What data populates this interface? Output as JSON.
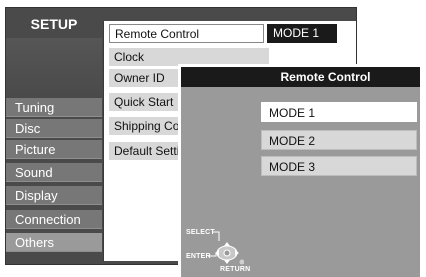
{
  "setup": {
    "title": "SETUP"
  },
  "sidebar": {
    "items": [
      {
        "label": "Tuning"
      },
      {
        "label": "Disc"
      },
      {
        "label": "Picture"
      },
      {
        "label": "Sound"
      },
      {
        "label": "Display"
      },
      {
        "label": "Connection"
      },
      {
        "label": "Others",
        "active": true
      }
    ]
  },
  "menu": {
    "items": [
      {
        "label": "Remote Control",
        "value": "MODE 1"
      },
      {
        "label": "Clock"
      },
      {
        "label": "Owner ID"
      },
      {
        "label": "Quick Start"
      },
      {
        "label": "Shipping Condition"
      },
      {
        "label": "Default Settings"
      }
    ]
  },
  "dialog": {
    "title": "Remote Control",
    "options": [
      {
        "label": "MODE 1",
        "selected": true
      },
      {
        "label": "MODE 2"
      },
      {
        "label": "MODE 3"
      }
    ]
  },
  "nav_hint": {
    "select": "SELECT",
    "enter": "ENTER",
    "return": "RETURN"
  },
  "colors": {
    "panel": "#4a4a4a",
    "sidebar_item": "#777777",
    "dialog": "#9a9a9a",
    "title_bar": "#1a1a1a",
    "highlight": "#ffffff"
  }
}
